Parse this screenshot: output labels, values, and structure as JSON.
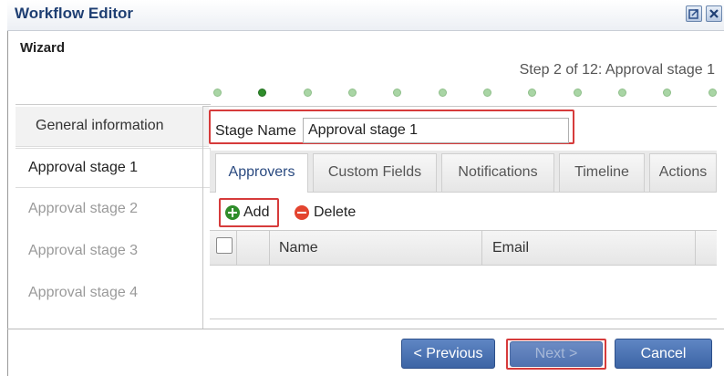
{
  "window": {
    "title": "Workflow Editor",
    "icons": [
      "maximize-icon",
      "close-icon"
    ]
  },
  "wizard": {
    "label": "Wizard",
    "step_text": "Step 2 of 12: Approval stage 1",
    "current_step": 2,
    "total_steps": 12,
    "visible_dots": 12
  },
  "nav": {
    "items": [
      {
        "label": "General information",
        "state": "default"
      },
      {
        "label": "Approval stage 1",
        "state": "active"
      },
      {
        "label": "Approval stage 2",
        "state": "inactive"
      },
      {
        "label": "Approval stage 3",
        "state": "inactive"
      },
      {
        "label": "Approval stage 4",
        "state": "inactive"
      }
    ]
  },
  "stage": {
    "name_label": "Stage Name",
    "name_value": "Approval stage 1"
  },
  "tabs": [
    {
      "label": "Approvers",
      "active": true
    },
    {
      "label": "Custom Fields",
      "active": false
    },
    {
      "label": "Notifications",
      "active": false
    },
    {
      "label": "Timeline",
      "active": false
    },
    {
      "label": "Actions",
      "active": false
    }
  ],
  "toolbar": {
    "add_label": "Add",
    "delete_label": "Delete"
  },
  "grid": {
    "columns": [
      "Name",
      "Email"
    ],
    "rows": []
  },
  "footer": {
    "previous_label": "< Previous",
    "next_label": "Next >",
    "cancel_label": "Cancel"
  },
  "colors": {
    "highlight": "#d63b3b",
    "title": "#1f3f73",
    "button": "#3c64a5",
    "dot_active": "#2f8d2b",
    "dot_inactive": "#a9d5a5"
  }
}
